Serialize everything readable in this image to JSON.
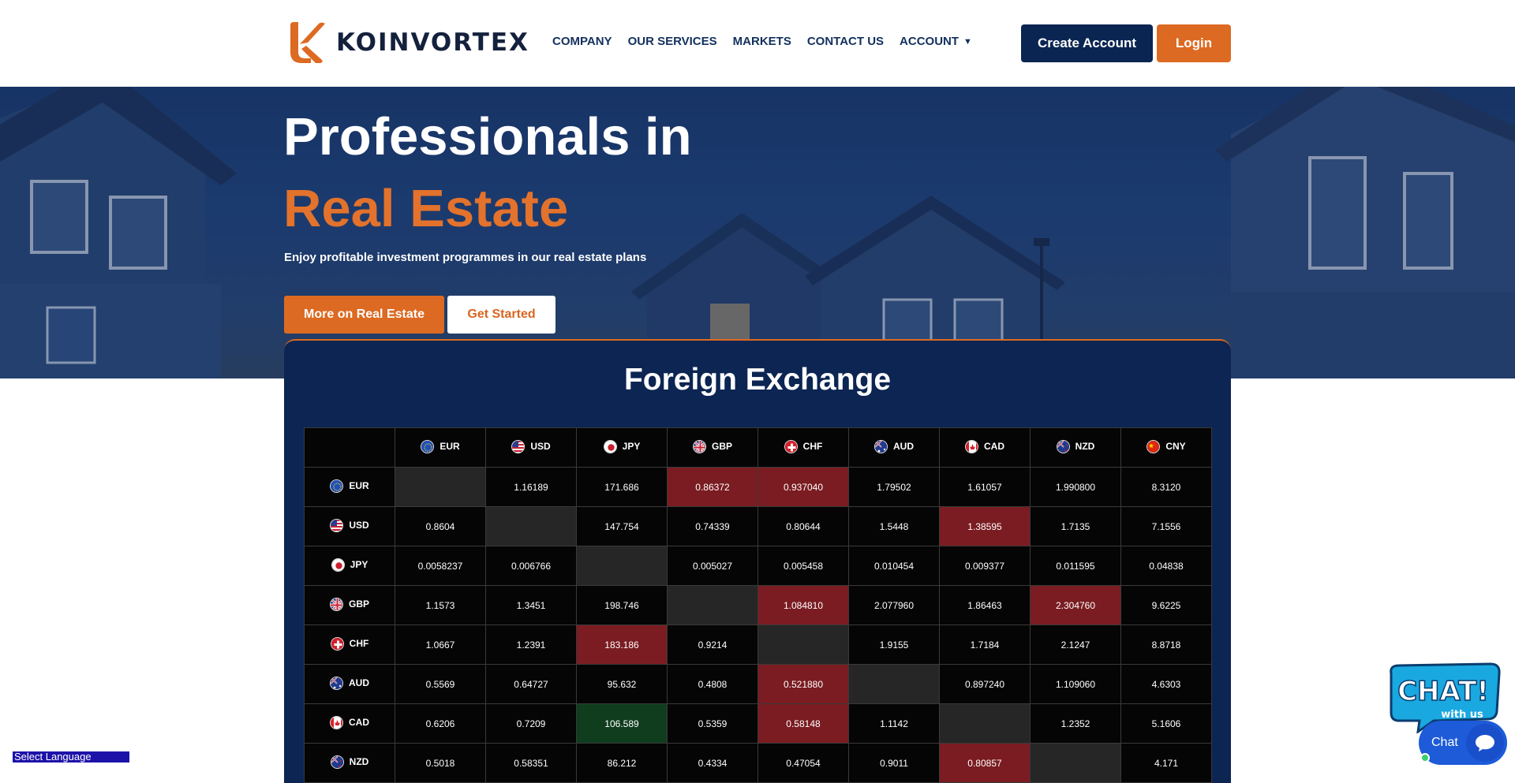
{
  "header": {
    "brand": "KOINVORTEX",
    "nav": [
      {
        "label": "COMPANY"
      },
      {
        "label": "OUR SERVICES"
      },
      {
        "label": "MARKETS"
      },
      {
        "label": "CONTACT US"
      },
      {
        "label": "ACCOUNT"
      }
    ],
    "create_account": "Create Account",
    "login": "Login"
  },
  "hero": {
    "title_line1": "Professionals in",
    "title_line2": "Real Estate",
    "subtitle": "Enjoy profitable investment programmes in our real estate plans",
    "btn_more": "More on Real Estate",
    "btn_start": "Get Started"
  },
  "fx": {
    "title": "Foreign Exchange",
    "currencies": [
      "EUR",
      "USD",
      "JPY",
      "GBP",
      "CHF",
      "AUD",
      "CAD",
      "NZD",
      "CNY"
    ],
    "rows": [
      {
        "code": "EUR",
        "cells": [
          {
            "v": "",
            "s": "diag"
          },
          {
            "v": "1.16189",
            "s": ""
          },
          {
            "v": "171.686",
            "s": ""
          },
          {
            "v": "0.86372",
            "s": "red"
          },
          {
            "v": "0.937040",
            "s": "red"
          },
          {
            "v": "1.79502",
            "s": ""
          },
          {
            "v": "1.61057",
            "s": ""
          },
          {
            "v": "1.990800",
            "s": ""
          },
          {
            "v": "8.3120",
            "s": ""
          }
        ]
      },
      {
        "code": "USD",
        "cells": [
          {
            "v": "0.8604",
            "s": ""
          },
          {
            "v": "",
            "s": "diag"
          },
          {
            "v": "147.754",
            "s": ""
          },
          {
            "v": "0.74339",
            "s": ""
          },
          {
            "v": "0.80644",
            "s": ""
          },
          {
            "v": "1.5448",
            "s": ""
          },
          {
            "v": "1.38595",
            "s": "red"
          },
          {
            "v": "1.7135",
            "s": ""
          },
          {
            "v": "7.1556",
            "s": ""
          }
        ]
      },
      {
        "code": "JPY",
        "cells": [
          {
            "v": "0.0058237",
            "s": ""
          },
          {
            "v": "0.006766",
            "s": ""
          },
          {
            "v": "",
            "s": "diag"
          },
          {
            "v": "0.005027",
            "s": ""
          },
          {
            "v": "0.005458",
            "s": ""
          },
          {
            "v": "0.010454",
            "s": ""
          },
          {
            "v": "0.009377",
            "s": ""
          },
          {
            "v": "0.011595",
            "s": ""
          },
          {
            "v": "0.04838",
            "s": ""
          }
        ]
      },
      {
        "code": "GBP",
        "cells": [
          {
            "v": "1.1573",
            "s": ""
          },
          {
            "v": "1.3451",
            "s": ""
          },
          {
            "v": "198.746",
            "s": ""
          },
          {
            "v": "",
            "s": "diag"
          },
          {
            "v": "1.084810",
            "s": "red"
          },
          {
            "v": "2.077960",
            "s": ""
          },
          {
            "v": "1.86463",
            "s": ""
          },
          {
            "v": "2.304760",
            "s": "red"
          },
          {
            "v": "9.6225",
            "s": ""
          }
        ]
      },
      {
        "code": "CHF",
        "cells": [
          {
            "v": "1.0667",
            "s": ""
          },
          {
            "v": "1.2391",
            "s": ""
          },
          {
            "v": "183.186",
            "s": "red"
          },
          {
            "v": "0.9214",
            "s": ""
          },
          {
            "v": "",
            "s": "diag"
          },
          {
            "v": "1.9155",
            "s": ""
          },
          {
            "v": "1.7184",
            "s": ""
          },
          {
            "v": "2.1247",
            "s": ""
          },
          {
            "v": "8.8718",
            "s": ""
          }
        ]
      },
      {
        "code": "AUD",
        "cells": [
          {
            "v": "0.5569",
            "s": ""
          },
          {
            "v": "0.64727",
            "s": ""
          },
          {
            "v": "95.632",
            "s": ""
          },
          {
            "v": "0.4808",
            "s": ""
          },
          {
            "v": "0.521880",
            "s": "red"
          },
          {
            "v": "",
            "s": "diag"
          },
          {
            "v": "0.897240",
            "s": ""
          },
          {
            "v": "1.109060",
            "s": ""
          },
          {
            "v": "4.6303",
            "s": ""
          }
        ]
      },
      {
        "code": "CAD",
        "cells": [
          {
            "v": "0.6206",
            "s": ""
          },
          {
            "v": "0.7209",
            "s": ""
          },
          {
            "v": "106.589",
            "s": "green"
          },
          {
            "v": "0.5359",
            "s": ""
          },
          {
            "v": "0.58148",
            "s": "red"
          },
          {
            "v": "1.1142",
            "s": ""
          },
          {
            "v": "",
            "s": "diag"
          },
          {
            "v": "1.2352",
            "s": ""
          },
          {
            "v": "5.1606",
            "s": ""
          }
        ]
      },
      {
        "code": "NZD",
        "cells": [
          {
            "v": "0.5018",
            "s": ""
          },
          {
            "v": "0.58351",
            "s": ""
          },
          {
            "v": "86.212",
            "s": ""
          },
          {
            "v": "0.4334",
            "s": ""
          },
          {
            "v": "0.47054",
            "s": ""
          },
          {
            "v": "0.9011",
            "s": ""
          },
          {
            "v": "0.80857",
            "s": "red"
          },
          {
            "v": "",
            "s": "diag"
          },
          {
            "v": "4.171",
            "s": ""
          }
        ]
      }
    ]
  },
  "language": {
    "label": "Select Language"
  },
  "chat": {
    "label": "Chat",
    "sticker_text": "CHAT!",
    "sticker_sub": "with us"
  },
  "colors": {
    "brand_orange": "#dd6a22",
    "navy": "#0b2552",
    "cell_red": "#7a1c21",
    "cell_green": "#0f3d1e"
  }
}
